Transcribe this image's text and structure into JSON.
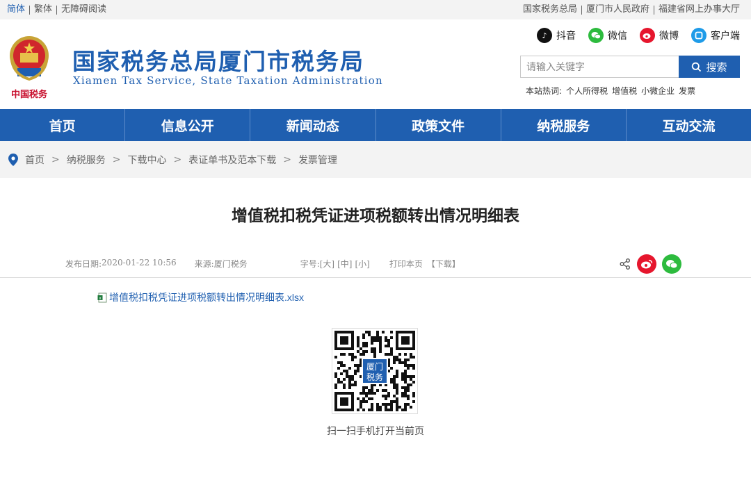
{
  "topbar": {
    "lang_simplified": "简体",
    "lang_traditional": "繁体",
    "accessibility": "无障碍阅读",
    "links": [
      "国家税务总局",
      "厦门市人民政府",
      "福建省网上办事大厅"
    ]
  },
  "header": {
    "emblem_text": "中国税务",
    "title": "国家税务总局厦门市税务局",
    "subtitle": "Xiamen Tax Service, State Taxation Administration",
    "socials": [
      {
        "label": "抖音",
        "icon": "tiktok-icon",
        "color": "#111111"
      },
      {
        "label": "微信",
        "icon": "wechat-icon",
        "color": "#2dbb3e"
      },
      {
        "label": "微博",
        "icon": "weibo-icon",
        "color": "#e6162d"
      },
      {
        "label": "客户端",
        "icon": "app-icon",
        "color": "#1e9be8"
      }
    ],
    "search_placeholder": "请输入关键字",
    "search_button": "搜索",
    "hot_label": "本站热词:",
    "hot_words": [
      "个人所得税",
      "增值税",
      "小微企业",
      "发票"
    ]
  },
  "nav": [
    "首页",
    "信息公开",
    "新闻动态",
    "政策文件",
    "纳税服务",
    "互动交流"
  ],
  "breadcrumb": [
    "首页",
    "纳税服务",
    "下载中心",
    "表证单书及范本下载",
    "发票管理"
  ],
  "article": {
    "title": "增值税扣税凭证进项税额转出情况明细表",
    "date_label": "发布日期:",
    "date": "2020-01-22 10:56",
    "source_label": "来源:",
    "source": "厦门税务",
    "font_label": "字号:",
    "font_large": "[大]",
    "font_medium": "[中]",
    "font_small": "[小]",
    "print": "打印本页",
    "download": "【下载】",
    "attachment": "增值税扣税凭证进项税额转出情况明细表.xlsx",
    "qr_label_top": "厦门",
    "qr_label_bottom": "税务",
    "qr_caption": "扫一扫手机打开当前页"
  },
  "colors": {
    "primary": "#1f5fb0",
    "weibo": "#e6162d",
    "wechat": "#2dbb3e"
  }
}
